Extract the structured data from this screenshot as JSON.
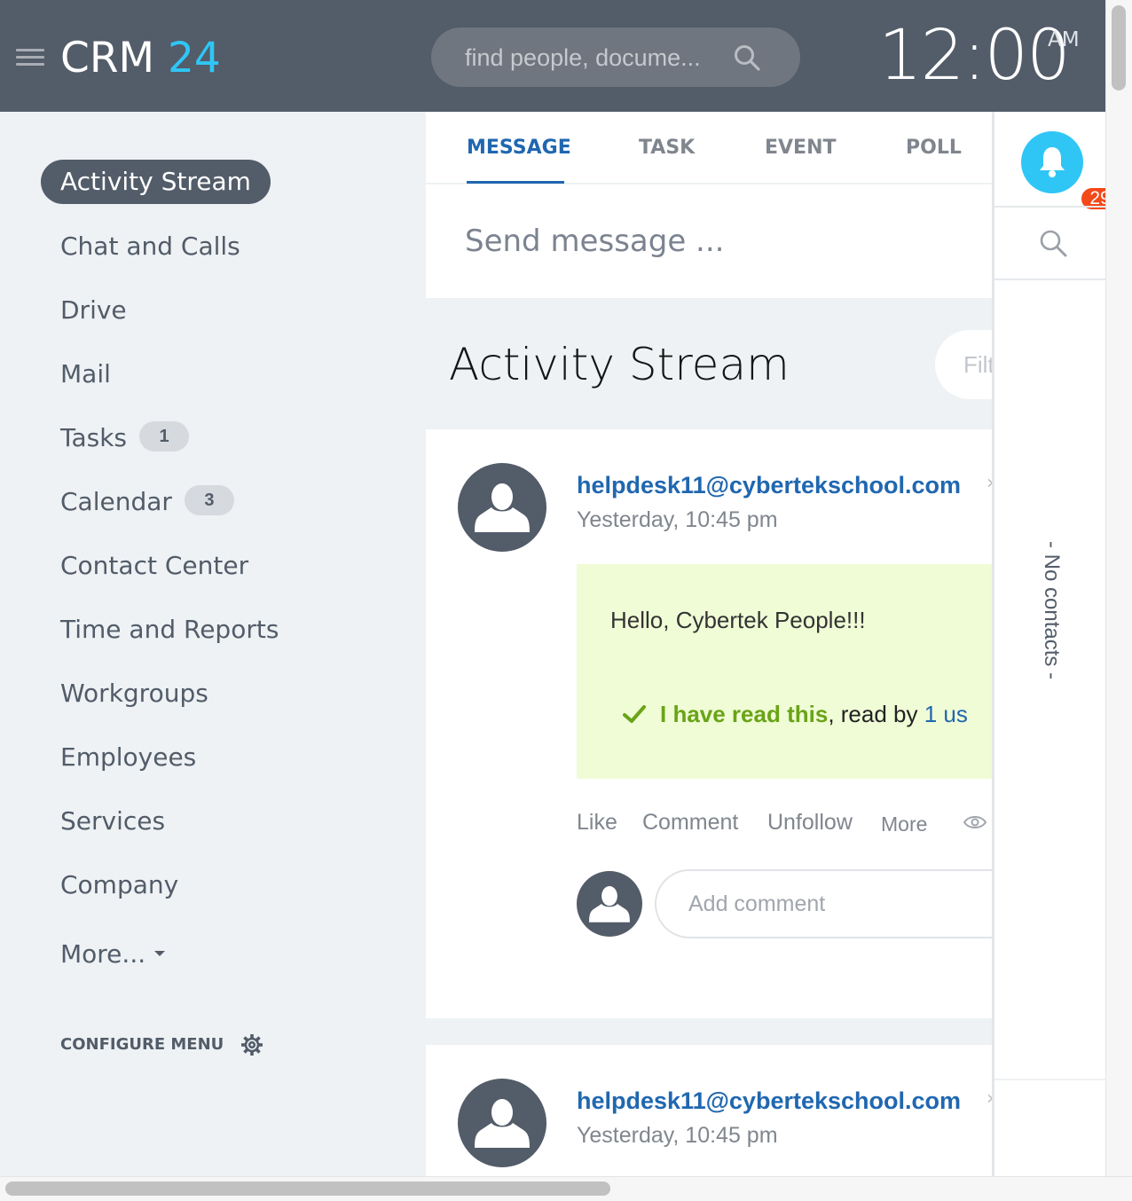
{
  "header": {
    "logo_prefix": "CRM",
    "logo_number": "24",
    "search_placeholder": "find people, docume...",
    "clock_time": "12:00",
    "clock_ampm": "AM"
  },
  "menu": {
    "active": "Activity Stream",
    "items": [
      {
        "label": "Chat and Calls"
      },
      {
        "label": "Drive"
      },
      {
        "label": "Mail"
      },
      {
        "label": "Tasks",
        "counter": "1"
      },
      {
        "label": "Calendar",
        "counter": "3"
      },
      {
        "label": "Contact Center"
      },
      {
        "label": "Time and Reports"
      },
      {
        "label": "Workgroups"
      },
      {
        "label": "Employees"
      },
      {
        "label": "Services"
      },
      {
        "label": "Company"
      },
      {
        "label": "More..."
      }
    ],
    "configure": "CONFIGURE MENU"
  },
  "composer": {
    "tabs": [
      "MESSAGE",
      "TASK",
      "EVENT",
      "POLL"
    ],
    "active_tab": "MESSAGE",
    "send_placeholder": "Send message ..."
  },
  "stream": {
    "title": "Activity Stream",
    "filter_placeholder": "Filt"
  },
  "posts": [
    {
      "author": "helpdesk11@cybertekschool.com",
      "date": "Yesterday, 10:45 pm",
      "message": "Hello, Cybertek People!!!",
      "read_link": "I have read this",
      "read_by_prefix": ", read by ",
      "read_by_count": "1 us",
      "actions": [
        "Like",
        "Comment",
        "Unfollow",
        "More"
      ],
      "comment_placeholder": "Add comment"
    },
    {
      "author": "helpdesk11@cybertekschool.com",
      "date": "Yesterday, 10:45 pm"
    }
  ],
  "right_panel": {
    "notification_count": "29",
    "no_contacts": "- No contacts -"
  },
  "colors": {
    "header_bg": "#535c69",
    "accent_blue": "#2fc6f6",
    "link_blue": "#2067b0",
    "read_green": "#69a417",
    "message_bg": "#f0fcd6",
    "badge_red": "#f54819"
  },
  "icons": [
    "menu-icon",
    "search-icon",
    "bell-icon",
    "gear-icon",
    "check-icon",
    "eye-icon",
    "user-avatar-icon"
  ]
}
